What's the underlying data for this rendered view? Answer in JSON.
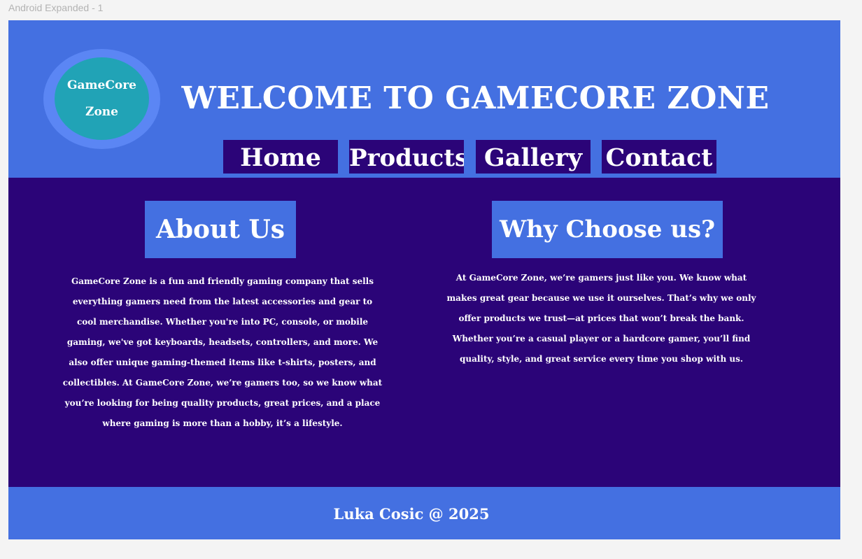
{
  "frame": {
    "label": "Android Expanded - 1"
  },
  "header": {
    "logo": {
      "line1": "GameCore",
      "line2": "Zone"
    },
    "title": "WELCOME TO GAMECORE ZONE",
    "nav": [
      {
        "label": "Home"
      },
      {
        "label": "Products"
      },
      {
        "label": "Gallery"
      },
      {
        "label": "Contact"
      }
    ]
  },
  "main": {
    "about": {
      "heading": "About Us",
      "text": "GameCore Zone is a fun and friendly gaming company that sells everything gamers need from the latest accessories and gear to cool merchandise. Whether you're into PC, console, or mobile gaming, we've got keyboards, headsets, controllers, and more. We also offer unique gaming-themed items like t-shirts, posters, and collectibles. At GameCore Zone, we’re gamers too, so we know what you’re looking for being quality products, great prices, and a place where gaming is more than a hobby, it’s a lifestyle."
    },
    "why": {
      "heading": "Why Choose us?",
      "text": "At GameCore Zone, we’re gamers just like you. We know what makes great gear because we use it ourselves. That’s why we only offer products we trust—at prices that won’t break the bank. Whether you’re a casual player or a hardcore gamer, you’ll find quality, style, and great service every time you shop with us."
    }
  },
  "footer": {
    "text": "Luka Cosic @ 2025"
  },
  "colors": {
    "header_blue": "#4470e1",
    "deep_purple": "#2b0478",
    "logo_ring": "#5b86f4",
    "logo_teal": "#21a3b6",
    "text": "#ffffff"
  }
}
